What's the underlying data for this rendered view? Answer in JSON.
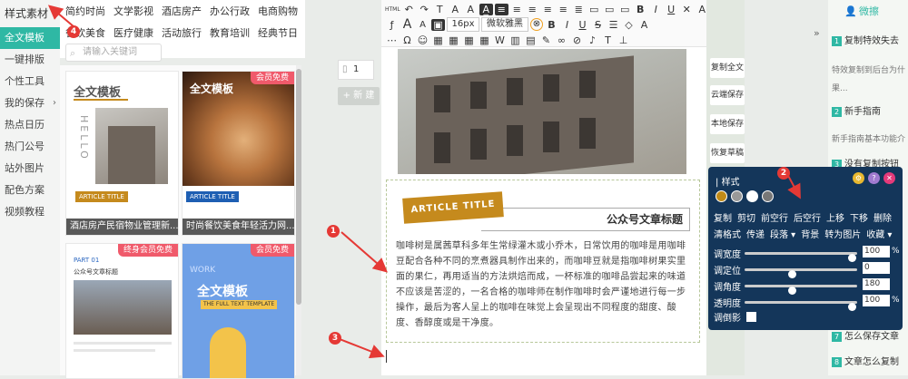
{
  "sidebar": {
    "items": [
      {
        "label": "样式素材",
        "active": false
      },
      {
        "label": "全文模板",
        "active": true
      },
      {
        "label": "一键排版",
        "active": false
      },
      {
        "label": "个性工具",
        "active": false
      },
      {
        "label": "我的保存",
        "active": false,
        "arrow": "›"
      },
      {
        "label": "热点日历",
        "active": false
      },
      {
        "label": "热门公号",
        "active": false
      },
      {
        "label": "站外图片",
        "active": false
      },
      {
        "label": "配色方案",
        "active": false
      },
      {
        "label": "视频教程",
        "active": false
      }
    ]
  },
  "categories": {
    "row1": [
      "简约时尚",
      "文学影视",
      "酒店房产",
      "办公行政",
      "电商购物"
    ],
    "row2": [
      "餐饮美食",
      "医疗健康",
      "活动旅行",
      "教育培训",
      "经典节日"
    ]
  },
  "search": {
    "placeholder": "请输入关键词"
  },
  "templates": [
    {
      "caption": "酒店房产民宿物业管理新...",
      "badge": "",
      "heading": "全文模板",
      "tag": "ARTICLE TITLE",
      "side": "HELLO"
    },
    {
      "caption": "时尚餐饮美食年轻活力网...",
      "badge": "会员免费",
      "heading": "全文模板",
      "tag": "ARTICLE TITLE"
    },
    {
      "caption": "",
      "badge": "终身会员免费",
      "heading": "公众号文章标题",
      "tag": "PART 01"
    },
    {
      "caption": "",
      "badge": "会员免费",
      "heading": "全文模板",
      "tag": "WORK",
      "sub": "THE FULL TEXT TEMPLATE"
    }
  ],
  "middle": {
    "page_tab": "1",
    "new_button": "+ 新 建"
  },
  "toolbar": {
    "row1": [
      "HTML",
      "↶",
      "↷",
      "T",
      "A",
      "A",
      "A̲",
      "≡",
      "≡",
      "≡",
      "≡",
      "≡",
      "≣",
      "▭",
      "▭",
      "▭",
      "B",
      "I",
      "U",
      "✕",
      "A"
    ],
    "row2": [
      "ƒ",
      "A",
      "A",
      "▣",
      "16px",
      "微软雅黑",
      "⊗",
      "B",
      "I",
      "U",
      "S",
      "☰",
      "◇",
      "A"
    ],
    "row3": [
      "⋯",
      "Ω",
      "☺",
      "▦",
      "▦",
      "▦",
      "▦",
      "W",
      "▥",
      "▤",
      "✎",
      "∞",
      "⊘",
      "♪",
      "T",
      "⊥"
    ]
  },
  "article": {
    "title_band": "ARTICLE TITLE",
    "title": "公众号文章标题",
    "paragraph": "咖啡树是属茜草科多年生常绿灌木或小乔木，日常饮用的咖啡是用咖啡豆配合各种不同的烹煮器具制作出来的，而咖啡豆就是指咖啡树果实里面的果仁，再用适当的方法烘焙而成，一杯标准的咖啡品尝起来的味道不应该是苦涩的，一名合格的咖啡师在制作咖啡时会严谨地进行每一步操作，最后为客人呈上的咖啡在味觉上会呈现出不同程度的甜度、酸度、香醇度或是干净度。"
  },
  "right_tools": [
    "复制全文",
    "云端保存",
    "本地保存",
    "恢复草稿"
  ],
  "right_panel": {
    "tab": "微擦",
    "collapse": "»",
    "tips": [
      {
        "num": "1",
        "text": "复制特效失去",
        "sub": "特效复制到后台为什"
      },
      {
        "num": "",
        "text": "果...",
        "sub": ""
      },
      {
        "num": "2",
        "text": "新手指南",
        "sub": "新手指南基本功能介"
      },
      {
        "num": "3",
        "text": "没有复制按钮",
        "sub": ""
      },
      {
        "num": "7",
        "text": "怎么保存文章",
        "sub": ""
      },
      {
        "num": "8",
        "text": "文章怎么复制",
        "sub": ""
      }
    ]
  },
  "popup": {
    "title": "样式",
    "swatches": [
      "#c08a18",
      "#999999",
      "#ffffff",
      "#777777"
    ],
    "actions1": [
      "复制",
      "剪切",
      "前空行",
      "后空行",
      "上移",
      "下移",
      "删除"
    ],
    "actions2": [
      "清格式",
      "传递",
      "段落 ▾",
      "背景",
      "转为图片",
      "收藏 ▾"
    ],
    "sliders": [
      {
        "label": "调宽度",
        "value": "100",
        "unit": "%",
        "level": 0.99
      },
      {
        "label": "调定位",
        "value": "0",
        "unit": "",
        "level": 0.42
      },
      {
        "label": "调角度",
        "value": "180",
        "unit": "",
        "level": 0.42
      },
      {
        "label": "透明度",
        "value": "100",
        "unit": "%",
        "level": 0.99
      }
    ],
    "shadow_label": "调倒影"
  },
  "markers": [
    "1",
    "2",
    "3",
    "4"
  ],
  "colors": {
    "accent": "#2fb8a4",
    "popup_bg": "#14365a",
    "badge": "#f05a6b",
    "title_band": "#c58a1d",
    "marker": "#e53935"
  }
}
